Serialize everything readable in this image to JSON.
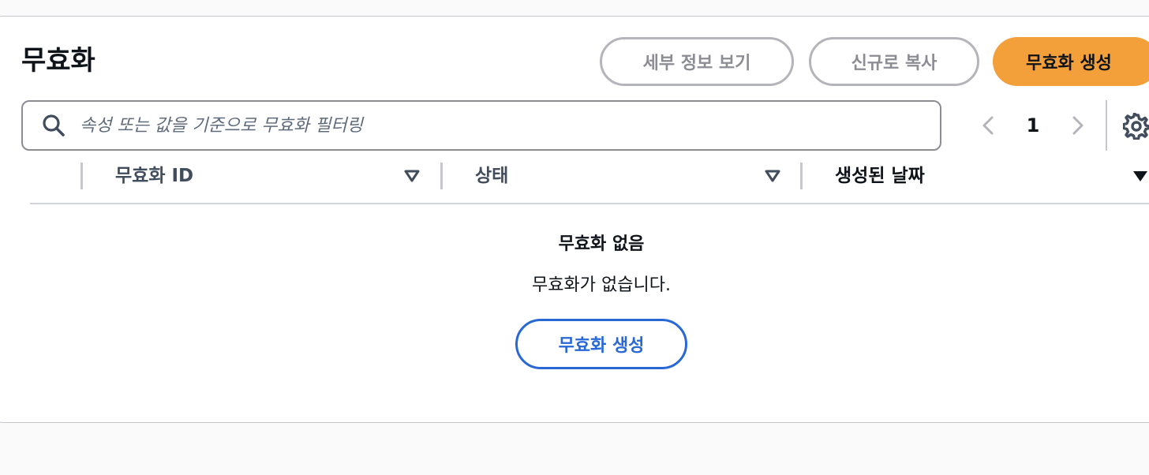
{
  "header": {
    "title": "무효화",
    "buttons": {
      "view_details": "세부 정보 보기",
      "copy_new": "신규로 복사",
      "create": "무효화 생성"
    }
  },
  "filter": {
    "placeholder": "속성 또는 값을 기준으로 무효화 필터링",
    "value": ""
  },
  "pagination": {
    "current_page": "1"
  },
  "table": {
    "columns": [
      "무효화 ID",
      "상태",
      "생성된 날짜"
    ]
  },
  "empty_state": {
    "title": "무효화 없음",
    "description": "무효화가 없습니다.",
    "button": "무효화 생성"
  },
  "colors": {
    "primary": "#f3a03a",
    "link": "#2868d6",
    "outline_disabled": "#b4b4bb"
  },
  "icons": [
    "search-icon",
    "chevron-left-icon",
    "chevron-right-icon",
    "gear-icon",
    "sort-icon",
    "sort-descending-icon"
  ]
}
